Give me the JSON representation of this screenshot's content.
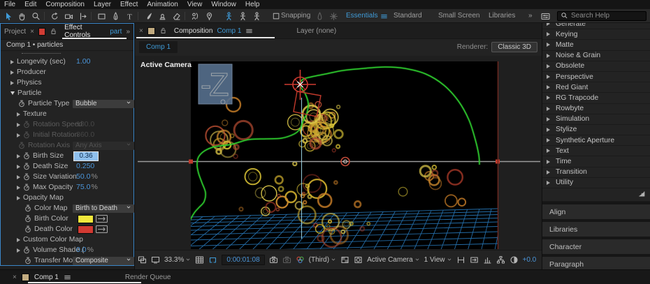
{
  "menu_items": [
    "File",
    "Edit",
    "Composition",
    "Layer",
    "Effect",
    "Animation",
    "View",
    "Window",
    "Help"
  ],
  "toolbar": {
    "tools": [
      "selection-tool",
      "hand-tool",
      "zoom-tool",
      "rotation-tool",
      "camera-tool",
      "pan-behind-tool",
      "shape-tool",
      "pen-tool",
      "type-tool",
      "brush-tool",
      "clone-stamp-tool",
      "eraser-tool",
      "roto-brush-tool",
      "puppet-pin-tool"
    ],
    "axis_modes": [
      "local-axis-mode",
      "world-axis-mode",
      "view-axis-mode"
    ],
    "snapping_label": "Snapping",
    "workspaces": [
      "Essentials",
      "Standard",
      "Small Screen",
      "Libraries"
    ],
    "active_workspace": "Essentials",
    "overflow_chevron": "»",
    "search_placeholder": "Search Help"
  },
  "effect_controls": {
    "tab_project": "Project",
    "tab_close": "×",
    "tab_title": "Effect Controls",
    "tab_accent": "part",
    "chevron": "»",
    "comp_line": "Comp 1 • particles",
    "rows": [
      {
        "type": "clipped",
        "label": ""
      },
      {
        "arrow": "r",
        "label": "Longevity (sec)",
        "value": "1.00"
      },
      {
        "arrow": "r",
        "label": "Producer"
      },
      {
        "arrow": "r",
        "label": "Physics"
      },
      {
        "arrow": "d",
        "label": "Particle"
      },
      {
        "stopwatch": true,
        "label": "Particle Type",
        "dropdown": "Bubble",
        "indent": 1
      },
      {
        "arrow": "r",
        "label": "Texture",
        "indent": 1
      },
      {
        "arrow": "r",
        "stopwatch": true,
        "label": "Rotation Speed",
        "value": "180.0",
        "disabled": true,
        "indent": 1
      },
      {
        "arrow": "r",
        "stopwatch": true,
        "label": "Initial Rotation",
        "value": "360.0",
        "disabled": true,
        "indent": 1
      },
      {
        "stopwatch": true,
        "label": "Rotation Axis",
        "dropdown": "Any Axis",
        "disabled": true,
        "indent": 1
      },
      {
        "arrow": "r",
        "stopwatch": true,
        "label": "Birth Size",
        "edit": "0.36",
        "indent": 1
      },
      {
        "arrow": "r",
        "stopwatch": true,
        "label": "Death Size",
        "value": "0.250",
        "indent": 1
      },
      {
        "arrow": "r",
        "stopwatch": true,
        "label": "Size Variation",
        "value": "50.0",
        "suffix": "%",
        "indent": 1
      },
      {
        "arrow": "r",
        "stopwatch": true,
        "label": "Max Opacity",
        "value": "75.0",
        "suffix": "%",
        "indent": 1
      },
      {
        "arrow": "r",
        "label": "Opacity Map",
        "indent": 1
      },
      {
        "stopwatch": true,
        "label": "Color Map",
        "dropdown": "Birth to Death",
        "indent": 2
      },
      {
        "stopwatch": true,
        "label": "Birth Color",
        "swatch": "#f2e73c",
        "indent": 2
      },
      {
        "stopwatch": true,
        "label": "Death Color",
        "swatch": "#d23a32",
        "indent": 2
      },
      {
        "arrow": "r",
        "label": "Custom Color Map",
        "indent": 1
      },
      {
        "arrow": "r",
        "stopwatch": true,
        "label": "Volume Shade (",
        "value": "0.0",
        "suffix": "%",
        "indent": 1
      },
      {
        "stopwatch": true,
        "label": "Transfer Mode",
        "dropdown": "Composite",
        "indent": 2
      }
    ]
  },
  "composition": {
    "tab_close": "×",
    "tab_title": "Composition",
    "tab_accent": "Comp 1",
    "layer_tab": "Layer (none)",
    "comp_tab": "Comp 1",
    "renderer_label": "Renderer:",
    "renderer_value": "Classic 3D",
    "view_label": "Active Camera",
    "axis_label": "-Z",
    "bottom": {
      "zoom": "33.3%",
      "timecode": "0:00:01:08",
      "resolution": "(Third)",
      "camera": "Active Camera",
      "views": "1 View",
      "exposure": "+0.0"
    }
  },
  "effects_panel": {
    "categories": [
      "Generate",
      "Keying",
      "Matte",
      "Noise & Grain",
      "Obsolete",
      "Perspective",
      "Red Giant",
      "RG Trapcode",
      "Rowbyte",
      "Simulation",
      "Stylize",
      "Synthetic Aperture",
      "Text",
      "Time",
      "Transition",
      "Utility"
    ],
    "panels": [
      "Align",
      "Libraries",
      "Character",
      "Paragraph"
    ]
  },
  "timeline_tabs": {
    "close": "×",
    "comp_tab": "Comp 1",
    "render_queue": "Render Queue"
  },
  "colors": {
    "accent": "#3f9bd8",
    "value_blue": "#4a94d8",
    "birth_color": "#f2e73c",
    "death_color": "#d23a32",
    "path_green": "#2ecc2e",
    "grid_blue": "#2a7fc4",
    "crosshair_red": "#d03a30"
  }
}
